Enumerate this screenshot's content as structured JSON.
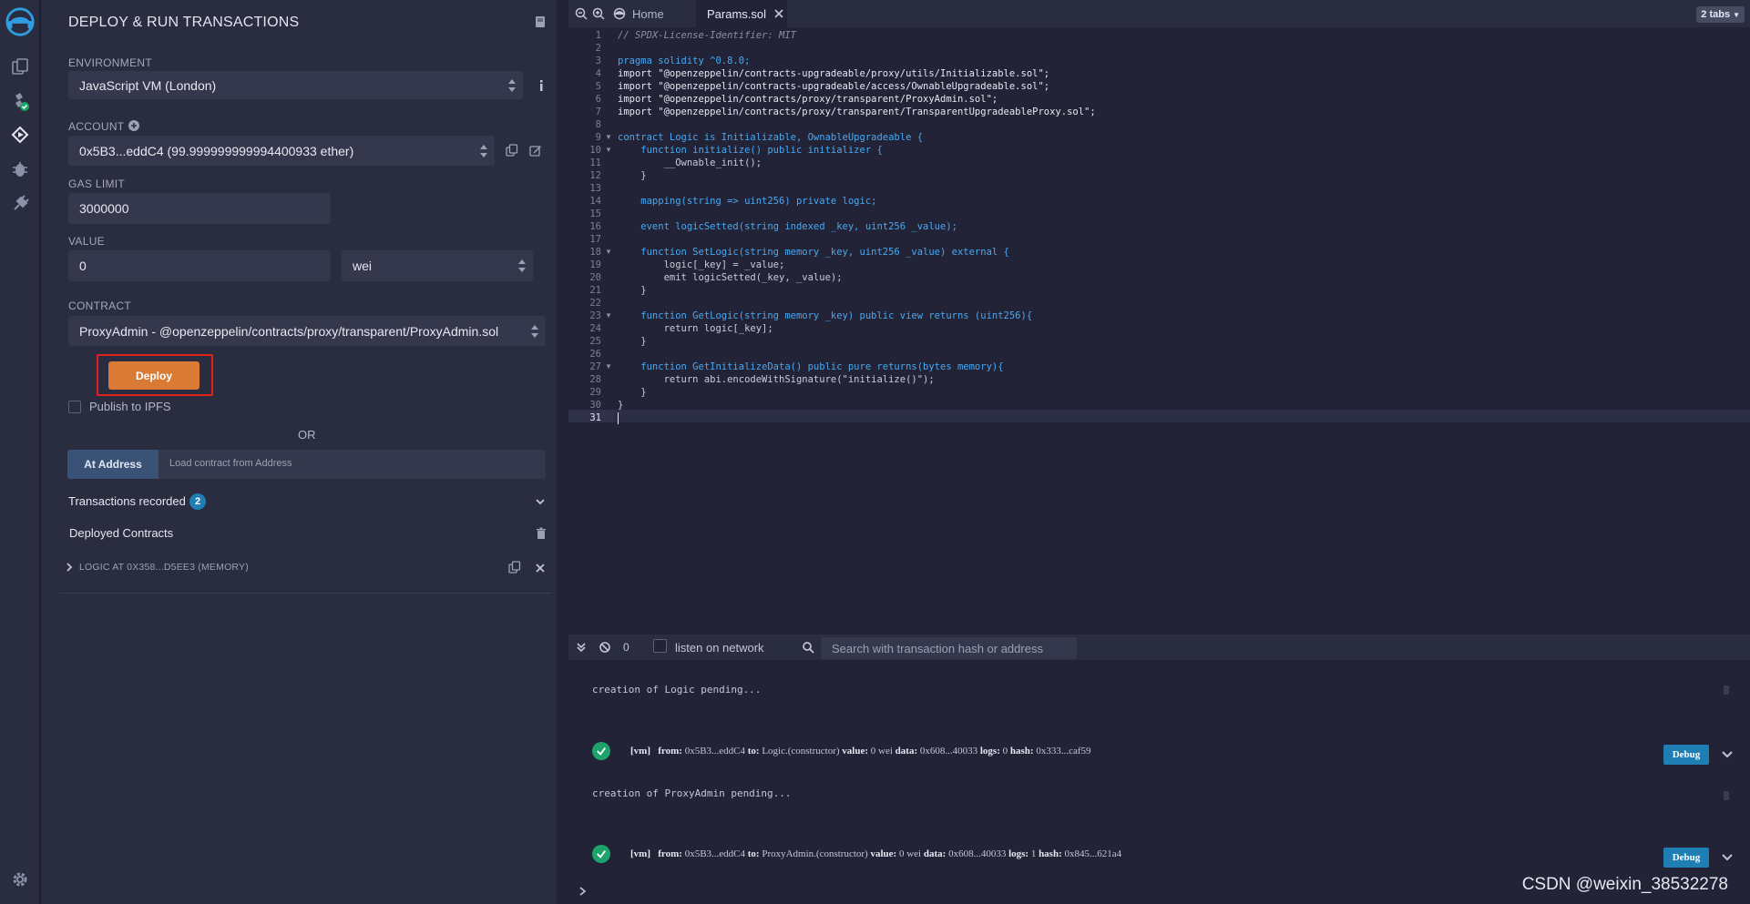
{
  "panel": {
    "title": "DEPLOY & RUN TRANSACTIONS",
    "environment_label": "ENVIRONMENT",
    "environment_value": "JavaScript VM (London)",
    "account_label": "ACCOUNT",
    "account_value": "0x5B3...eddC4 (99.999999999994400933 ether)",
    "gas_limit_label": "GAS LIMIT",
    "gas_limit_value": "3000000",
    "value_label": "VALUE",
    "value_amount": "0",
    "value_unit": "wei",
    "contract_label": "CONTRACT",
    "contract_value": "ProxyAdmin - @openzeppelin/contracts/proxy/transparent/ProxyAdmin.sol",
    "deploy_label": "Deploy",
    "publish_label": "Publish to IPFS",
    "or_label": "OR",
    "at_address_label": "At Address",
    "at_address_placeholder": "Load contract from Address",
    "transactions_label": "Transactions recorded",
    "transactions_count": "2",
    "deployed_label": "Deployed Contracts",
    "deployed_item": "LOGIC AT 0X358...D5EE3 (MEMORY)"
  },
  "editor": {
    "home_tab": "Home",
    "file_tab": "Params.sol",
    "tabs_count": "2 tabs",
    "lines": [
      "// SPDX-License-Identifier: MIT",
      "",
      "pragma solidity ^0.8.0;",
      "import \"@openzeppelin/contracts-upgradeable/proxy/utils/Initializable.sol\";",
      "import \"@openzeppelin/contracts-upgradeable/access/OwnableUpgradeable.sol\";",
      "import \"@openzeppelin/contracts/proxy/transparent/ProxyAdmin.sol\";",
      "import \"@openzeppelin/contracts/proxy/transparent/TransparentUpgradeableProxy.sol\";",
      "",
      "contract Logic is Initializable, OwnableUpgradeable {",
      "    function initialize() public initializer {",
      "        __Ownable_init();",
      "    }",
      "",
      "    mapping(string => uint256) private logic;",
      "",
      "    event logicSetted(string indexed _key, uint256 _value);",
      "",
      "    function SetLogic(string memory _key, uint256 _value) external {",
      "        logic[_key] = _value;",
      "        emit logicSetted(_key, _value);",
      "    }",
      "",
      "    function GetLogic(string memory _key) public view returns (uint256){",
      "        return logic[_key];",
      "    }",
      "",
      "    function GetInitializeData() public pure returns(bytes memory){",
      "        return abi.encodeWithSignature(\"initialize()\");",
      "    }",
      "}",
      ""
    ]
  },
  "terminal": {
    "count": "0",
    "listen_label": "listen on network",
    "search_placeholder": "Search with transaction hash or address",
    "pending1": "creation of Logic pending...",
    "tx1": {
      "vm": "[vm]",
      "from_label": "from:",
      "from": "0x5B3...eddC4",
      "to_label": "to:",
      "to": "Logic.(constructor)",
      "value_label": "value:",
      "value": "0 wei",
      "data_label": "data:",
      "data": "0x608...40033",
      "logs_label": "logs:",
      "logs": "0",
      "hash_label": "hash:",
      "hash": "0x333...caf59"
    },
    "pending2": "creation of ProxyAdmin pending...",
    "tx2": {
      "vm": "[vm]",
      "from_label": "from:",
      "from": "0x5B3...eddC4",
      "to_label": "to:",
      "to": "ProxyAdmin.(constructor)",
      "value_label": "value:",
      "value": "0 wei",
      "data_label": "data:",
      "data": "0x608...40033",
      "logs_label": "logs:",
      "logs": "1",
      "hash_label": "hash:",
      "hash": "0x845...621a4"
    },
    "debug_label": "Debug"
  },
  "watermark": "CSDN @weixin_38532278"
}
